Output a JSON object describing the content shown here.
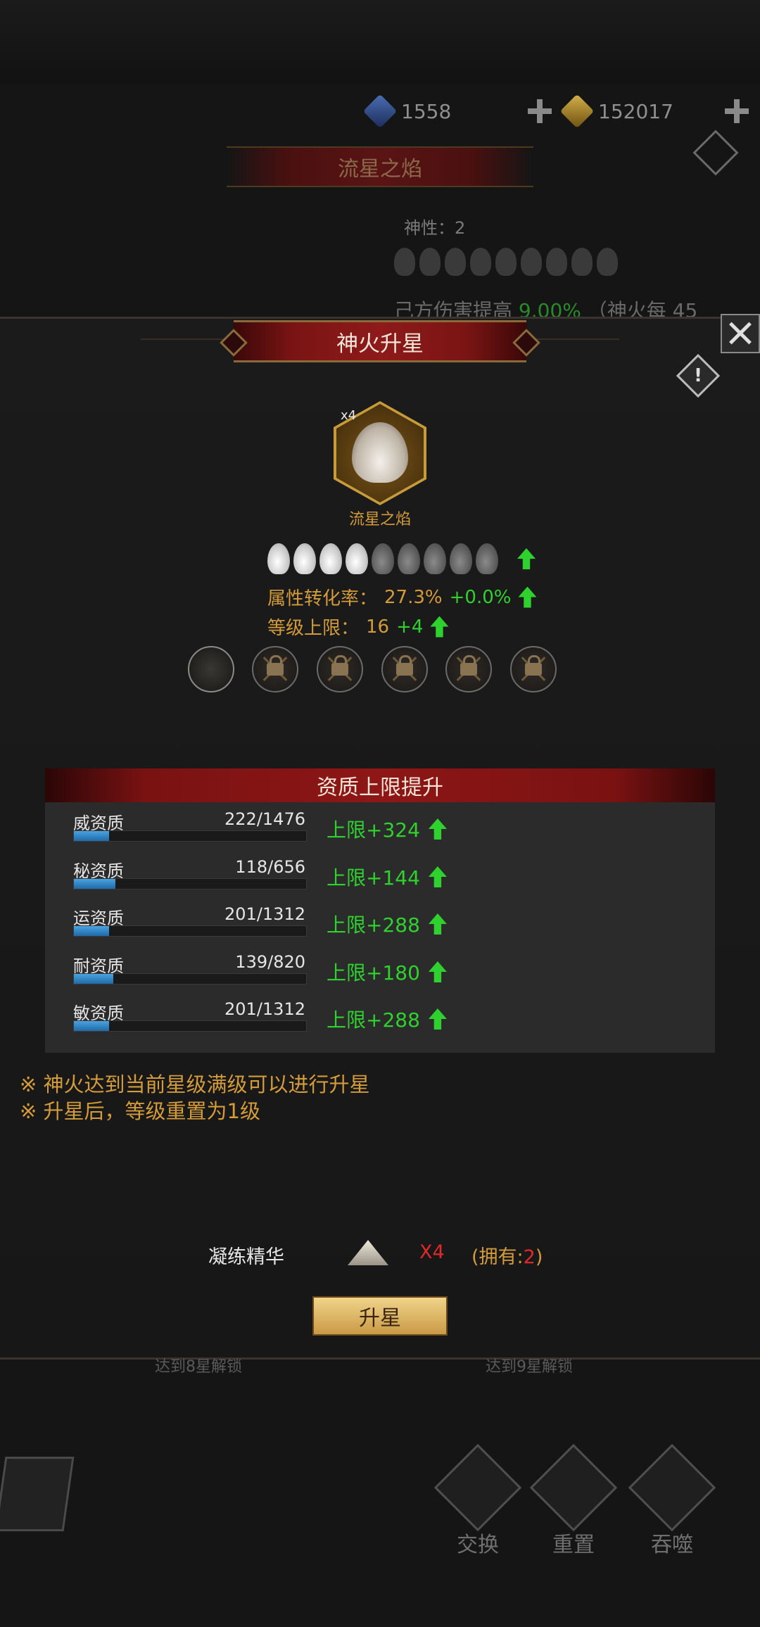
{
  "topbar": {
    "blue_amount": "1558",
    "gold_amount": "152017"
  },
  "background_screen": {
    "title": "流星之焰",
    "divinity": "神性：2",
    "damage_text": "己方伤害提高",
    "damage_value": "9.00%",
    "damage_suffix": "（神火每 45",
    "unlock_8": "达到8星解锁",
    "unlock_9": "达到9星解锁",
    "actions": [
      {
        "label": "交换"
      },
      {
        "label": "重置"
      },
      {
        "label": "吞噬"
      }
    ]
  },
  "modal": {
    "title": "神火升星",
    "item": {
      "name": "流星之焰",
      "count_badge": "x4"
    },
    "stars": {
      "filled": 4,
      "total": 9
    },
    "conversion": {
      "label": "属性转化率：",
      "value": "27.3%",
      "bonus": "+0.0%"
    },
    "level_cap": {
      "label": "等级上限：",
      "value": "16",
      "bonus": "+4"
    },
    "slots": {
      "unlocked": 1,
      "locked": 5
    },
    "aptitude": {
      "title": "资质上限提升",
      "rows": [
        {
          "label": "威资质",
          "value": "222/1476",
          "fill": 0.15,
          "bonus": "上限+324"
        },
        {
          "label": "秘资质",
          "value": "118/656",
          "fill": 0.18,
          "bonus": "上限+144"
        },
        {
          "label": "运资质",
          "value": "201/1312",
          "fill": 0.15,
          "bonus": "上限+288"
        },
        {
          "label": "耐资质",
          "value": "139/820",
          "fill": 0.17,
          "bonus": "上限+180"
        },
        {
          "label": "敏资质",
          "value": "201/1312",
          "fill": 0.15,
          "bonus": "上限+288"
        }
      ]
    },
    "notes": [
      "※ 神火达到当前星级满级可以进行升星",
      "※ 升星后，等级重置为1级"
    ],
    "cost": {
      "label": "凝练精华",
      "qty": "X4",
      "own_prefix": "(拥有:",
      "own_value": "2",
      "own_suffix": ")"
    },
    "upgrade_label": "升星"
  }
}
